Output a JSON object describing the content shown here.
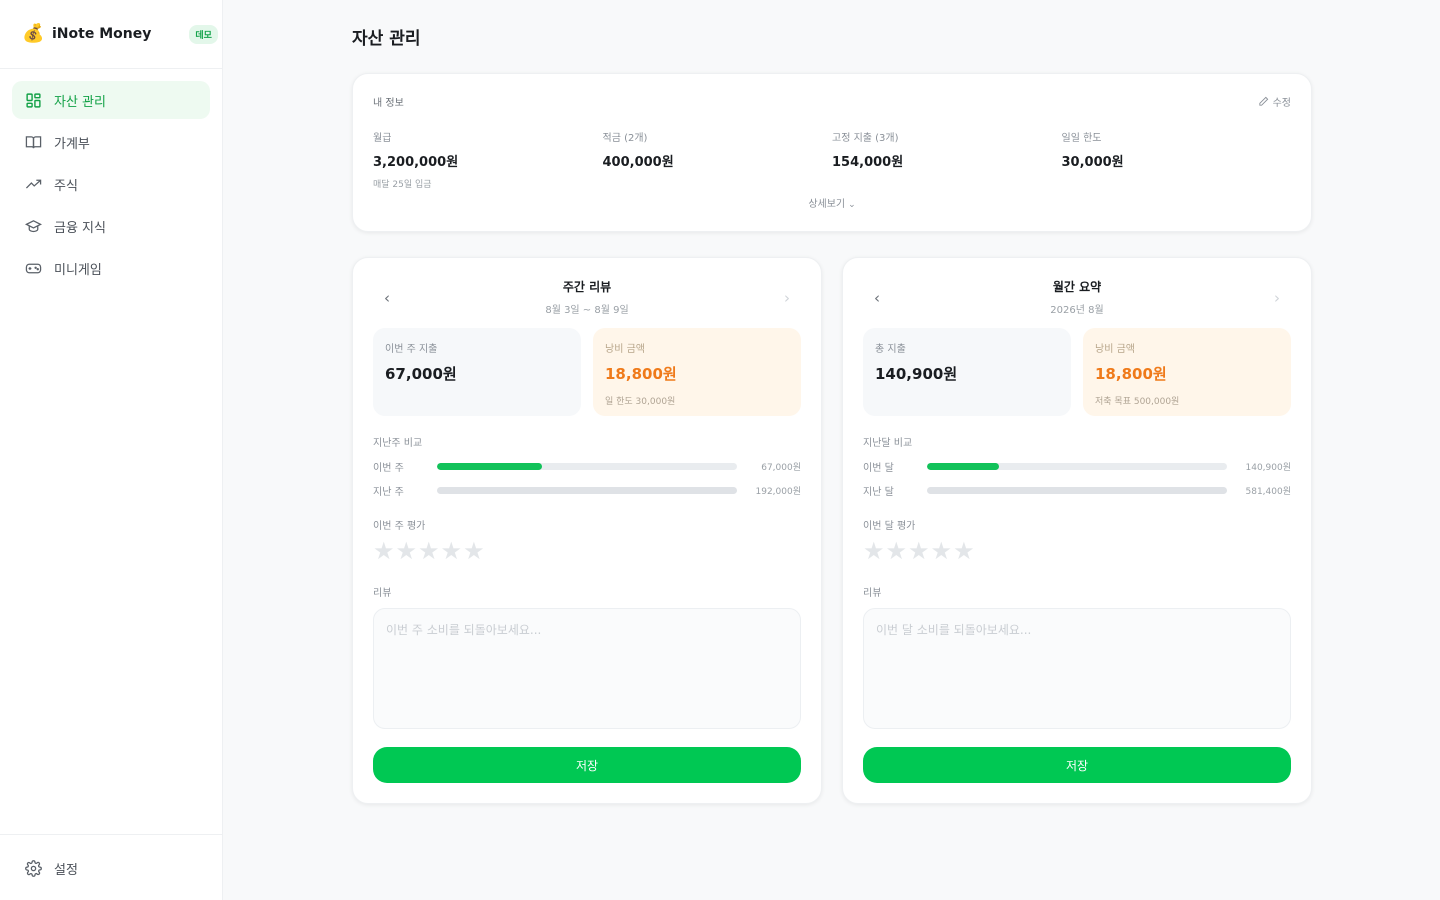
{
  "brand": {
    "name": "iNote Money",
    "badge": "데모",
    "logo_icon": "money-bag-icon"
  },
  "nav": [
    {
      "label": "자산 관리",
      "icon": "dashboard-grid-icon",
      "active": true
    },
    {
      "label": "가계부",
      "icon": "open-book-icon",
      "active": false
    },
    {
      "label": "주식",
      "icon": "trending-up-icon",
      "active": false
    },
    {
      "label": "금융 지식",
      "icon": "graduation-cap-icon",
      "active": false
    },
    {
      "label": "미니게임",
      "icon": "gamepad-icon",
      "active": false
    }
  ],
  "footer": {
    "label": "설정",
    "icon": "gear-icon"
  },
  "page": {
    "title": "자산 관리"
  },
  "info": {
    "title": "내 정보",
    "edit_label": "수정",
    "items": [
      {
        "label": "월급",
        "value": "3,200,000원",
        "sub": "매달 25일 입금"
      },
      {
        "label": "적금 (2개)",
        "value": "400,000원"
      },
      {
        "label": "고정 지출 (3개)",
        "value": "154,000원"
      },
      {
        "label": "일일 한도",
        "value": "30,000원"
      }
    ],
    "more_label": "상세보기"
  },
  "weekly": {
    "title": "주간 리뷰",
    "period": "8월 3일 ~ 8월 9일",
    "stat1": {
      "label": "이번 주 지출",
      "value": "67,000원"
    },
    "stat2": {
      "label": "낭비 금액",
      "value": "18,800원",
      "sub": "일 한도 30,000원"
    },
    "compare_label": "지난주 비교",
    "bars": [
      {
        "name": "이번 주",
        "amount": "67,000원",
        "fraction": 0.35
      },
      {
        "name": "지난 주",
        "amount": "192,000원",
        "fraction": 1.0
      }
    ],
    "rating_label": "이번 주 평가",
    "rating": 0,
    "review_label": "리뷰",
    "review_placeholder": "이번 주 소비를 되돌아보세요...",
    "save_label": "저장"
  },
  "monthly": {
    "title": "월간 요약",
    "period": "2026년 8월",
    "stat1": {
      "label": "총 지출",
      "value": "140,900원"
    },
    "stat2": {
      "label": "낭비 금액",
      "value": "18,800원",
      "sub": "저축 목표 500,000원"
    },
    "compare_label": "지난달 비교",
    "bars": [
      {
        "name": "이번 달",
        "amount": "140,900원",
        "fraction": 0.24
      },
      {
        "name": "지난 달",
        "amount": "581,400원",
        "fraction": 1.0
      }
    ],
    "rating_label": "이번 달 평가",
    "rating": 0,
    "review_label": "리뷰",
    "review_placeholder": "이번 달 소비를 되돌아보세요...",
    "save_label": "저장"
  },
  "colors": {
    "accent": "#00c853",
    "warn": "#ef7a1a",
    "active_nav_bg": "#eefaf1"
  }
}
